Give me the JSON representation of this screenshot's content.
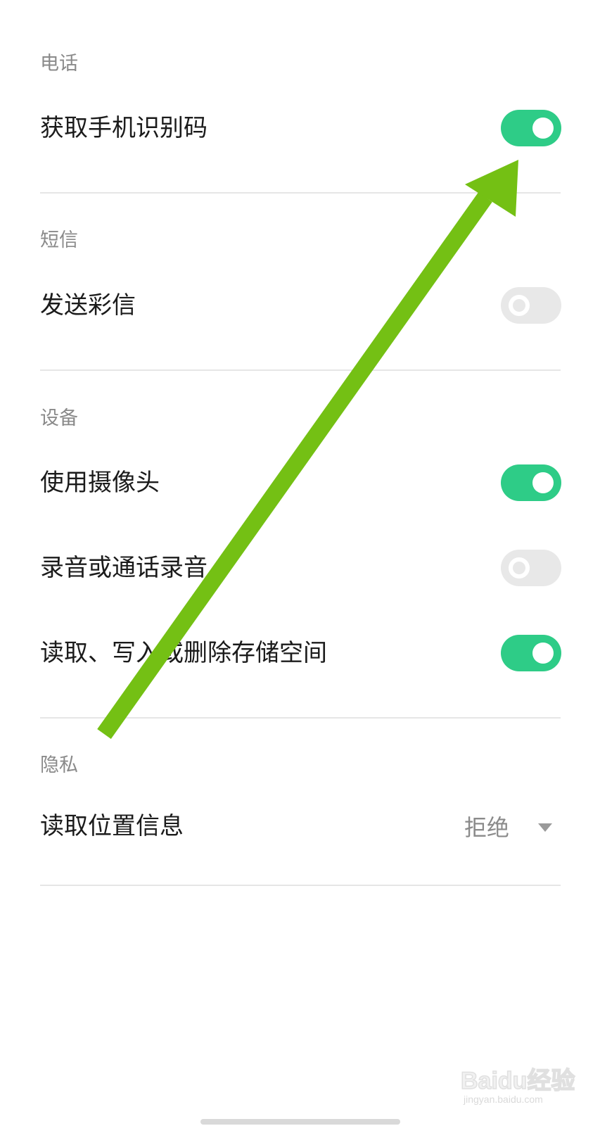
{
  "sections": {
    "phone": {
      "title": "电话",
      "items": [
        {
          "label": "获取手机识别码",
          "enabled": true
        }
      ]
    },
    "sms": {
      "title": "短信",
      "items": [
        {
          "label": "发送彩信",
          "enabled": false
        }
      ]
    },
    "device": {
      "title": "设备",
      "items": [
        {
          "label": "使用摄像头",
          "enabled": true
        },
        {
          "label": "录音或通话录音",
          "enabled": false
        },
        {
          "label": "读取、写入或删除存储空间",
          "enabled": true
        }
      ]
    },
    "privacy": {
      "title": "隐私",
      "items": [
        {
          "label": "读取位置信息",
          "value": "拒绝"
        }
      ]
    }
  },
  "colors": {
    "toggle_on": "#2ecc87",
    "toggle_off": "#e8e8e8",
    "annotation_arrow": "#74c014"
  },
  "watermark": {
    "brand": "Baidu经验",
    "sub": "jingyan.baidu.com"
  }
}
